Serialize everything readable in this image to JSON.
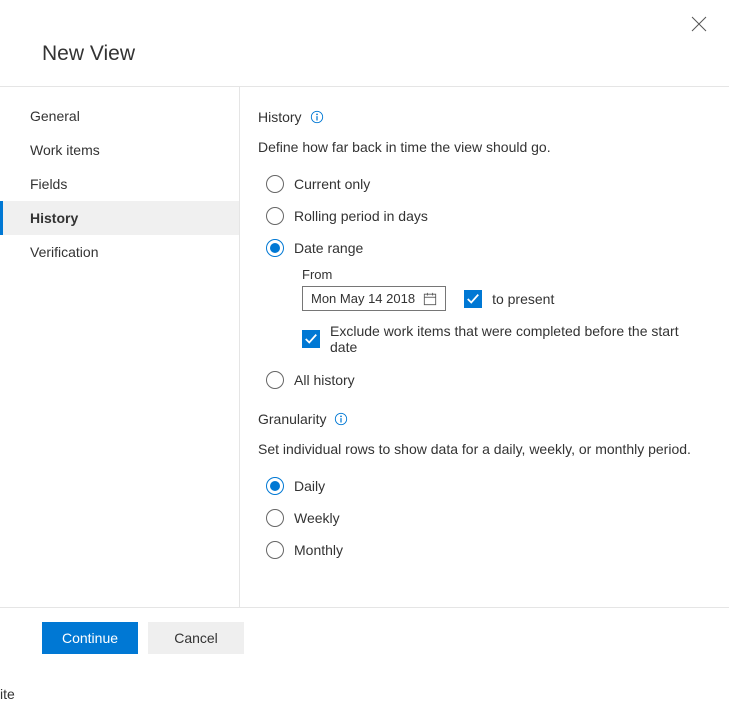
{
  "dialog": {
    "title": "New View"
  },
  "sidebar": {
    "items": [
      {
        "label": "General"
      },
      {
        "label": "Work items"
      },
      {
        "label": "Fields"
      },
      {
        "label": "History"
      },
      {
        "label": "Verification"
      }
    ]
  },
  "history": {
    "heading": "History",
    "description": "Define how far back in time the view should go.",
    "options": {
      "current_only": "Current only",
      "rolling": "Rolling period in days",
      "date_range": "Date range",
      "all_history": "All history"
    },
    "date_range": {
      "from_label": "From",
      "from_value": "Mon May 14 2018",
      "to_present_label": "to present",
      "exclude_label": "Exclude work items that were completed before the start date"
    }
  },
  "granularity": {
    "heading": "Granularity",
    "description": "Set individual rows to show data for a daily, weekly, or monthly period.",
    "options": {
      "daily": "Daily",
      "weekly": "Weekly",
      "monthly": "Monthly"
    }
  },
  "footer": {
    "continue": "Continue",
    "cancel": "Cancel"
  }
}
